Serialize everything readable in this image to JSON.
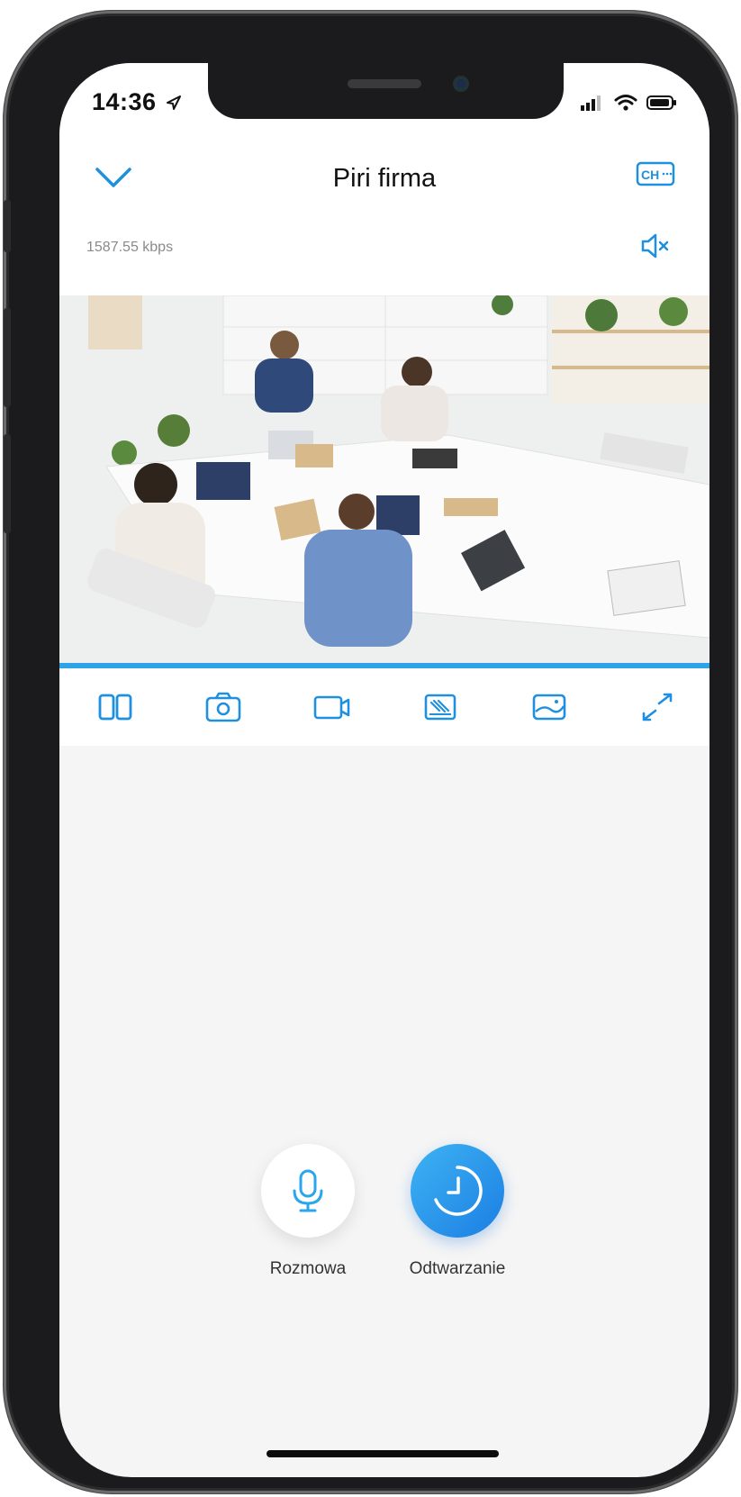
{
  "status_bar": {
    "time": "14:36"
  },
  "header": {
    "title": "Piri firma",
    "bitrate": "1587.55 kbps"
  },
  "toolbar": {
    "items": [
      "split-view-icon",
      "camera-icon",
      "video-record-icon",
      "image-quality-icon",
      "picture-icon",
      "fullscreen-icon"
    ]
  },
  "actions": {
    "talk_label": "Rozmowa",
    "playback_label": "Odtwarzanie"
  },
  "colors": {
    "accent": "#2ea3ea",
    "icon": "#1f8fe0",
    "background": "#f5f5f5"
  }
}
